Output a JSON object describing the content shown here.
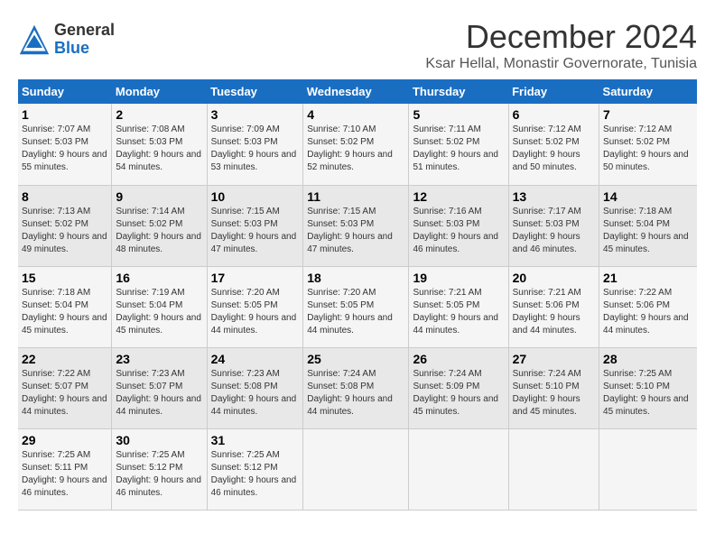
{
  "logo": {
    "general": "General",
    "blue": "Blue"
  },
  "title": "December 2024",
  "subtitle": "Ksar Hellal, Monastir Governorate, Tunisia",
  "days_of_week": [
    "Sunday",
    "Monday",
    "Tuesday",
    "Wednesday",
    "Thursday",
    "Friday",
    "Saturday"
  ],
  "weeks": [
    [
      {
        "day": "1",
        "sunrise": "Sunrise: 7:07 AM",
        "sunset": "Sunset: 5:03 PM",
        "daylight": "Daylight: 9 hours and 55 minutes."
      },
      {
        "day": "2",
        "sunrise": "Sunrise: 7:08 AM",
        "sunset": "Sunset: 5:03 PM",
        "daylight": "Daylight: 9 hours and 54 minutes."
      },
      {
        "day": "3",
        "sunrise": "Sunrise: 7:09 AM",
        "sunset": "Sunset: 5:03 PM",
        "daylight": "Daylight: 9 hours and 53 minutes."
      },
      {
        "day": "4",
        "sunrise": "Sunrise: 7:10 AM",
        "sunset": "Sunset: 5:02 PM",
        "daylight": "Daylight: 9 hours and 52 minutes."
      },
      {
        "day": "5",
        "sunrise": "Sunrise: 7:11 AM",
        "sunset": "Sunset: 5:02 PM",
        "daylight": "Daylight: 9 hours and 51 minutes."
      },
      {
        "day": "6",
        "sunrise": "Sunrise: 7:12 AM",
        "sunset": "Sunset: 5:02 PM",
        "daylight": "Daylight: 9 hours and 50 minutes."
      },
      {
        "day": "7",
        "sunrise": "Sunrise: 7:12 AM",
        "sunset": "Sunset: 5:02 PM",
        "daylight": "Daylight: 9 hours and 50 minutes."
      }
    ],
    [
      {
        "day": "8",
        "sunrise": "Sunrise: 7:13 AM",
        "sunset": "Sunset: 5:02 PM",
        "daylight": "Daylight: 9 hours and 49 minutes."
      },
      {
        "day": "9",
        "sunrise": "Sunrise: 7:14 AM",
        "sunset": "Sunset: 5:02 PM",
        "daylight": "Daylight: 9 hours and 48 minutes."
      },
      {
        "day": "10",
        "sunrise": "Sunrise: 7:15 AM",
        "sunset": "Sunset: 5:03 PM",
        "daylight": "Daylight: 9 hours and 47 minutes."
      },
      {
        "day": "11",
        "sunrise": "Sunrise: 7:15 AM",
        "sunset": "Sunset: 5:03 PM",
        "daylight": "Daylight: 9 hours and 47 minutes."
      },
      {
        "day": "12",
        "sunrise": "Sunrise: 7:16 AM",
        "sunset": "Sunset: 5:03 PM",
        "daylight": "Daylight: 9 hours and 46 minutes."
      },
      {
        "day": "13",
        "sunrise": "Sunrise: 7:17 AM",
        "sunset": "Sunset: 5:03 PM",
        "daylight": "Daylight: 9 hours and 46 minutes."
      },
      {
        "day": "14",
        "sunrise": "Sunrise: 7:18 AM",
        "sunset": "Sunset: 5:04 PM",
        "daylight": "Daylight: 9 hours and 45 minutes."
      }
    ],
    [
      {
        "day": "15",
        "sunrise": "Sunrise: 7:18 AM",
        "sunset": "Sunset: 5:04 PM",
        "daylight": "Daylight: 9 hours and 45 minutes."
      },
      {
        "day": "16",
        "sunrise": "Sunrise: 7:19 AM",
        "sunset": "Sunset: 5:04 PM",
        "daylight": "Daylight: 9 hours and 45 minutes."
      },
      {
        "day": "17",
        "sunrise": "Sunrise: 7:20 AM",
        "sunset": "Sunset: 5:05 PM",
        "daylight": "Daylight: 9 hours and 44 minutes."
      },
      {
        "day": "18",
        "sunrise": "Sunrise: 7:20 AM",
        "sunset": "Sunset: 5:05 PM",
        "daylight": "Daylight: 9 hours and 44 minutes."
      },
      {
        "day": "19",
        "sunrise": "Sunrise: 7:21 AM",
        "sunset": "Sunset: 5:05 PM",
        "daylight": "Daylight: 9 hours and 44 minutes."
      },
      {
        "day": "20",
        "sunrise": "Sunrise: 7:21 AM",
        "sunset": "Sunset: 5:06 PM",
        "daylight": "Daylight: 9 hours and 44 minutes."
      },
      {
        "day": "21",
        "sunrise": "Sunrise: 7:22 AM",
        "sunset": "Sunset: 5:06 PM",
        "daylight": "Daylight: 9 hours and 44 minutes."
      }
    ],
    [
      {
        "day": "22",
        "sunrise": "Sunrise: 7:22 AM",
        "sunset": "Sunset: 5:07 PM",
        "daylight": "Daylight: 9 hours and 44 minutes."
      },
      {
        "day": "23",
        "sunrise": "Sunrise: 7:23 AM",
        "sunset": "Sunset: 5:07 PM",
        "daylight": "Daylight: 9 hours and 44 minutes."
      },
      {
        "day": "24",
        "sunrise": "Sunrise: 7:23 AM",
        "sunset": "Sunset: 5:08 PM",
        "daylight": "Daylight: 9 hours and 44 minutes."
      },
      {
        "day": "25",
        "sunrise": "Sunrise: 7:24 AM",
        "sunset": "Sunset: 5:08 PM",
        "daylight": "Daylight: 9 hours and 44 minutes."
      },
      {
        "day": "26",
        "sunrise": "Sunrise: 7:24 AM",
        "sunset": "Sunset: 5:09 PM",
        "daylight": "Daylight: 9 hours and 45 minutes."
      },
      {
        "day": "27",
        "sunrise": "Sunrise: 7:24 AM",
        "sunset": "Sunset: 5:10 PM",
        "daylight": "Daylight: 9 hours and 45 minutes."
      },
      {
        "day": "28",
        "sunrise": "Sunrise: 7:25 AM",
        "sunset": "Sunset: 5:10 PM",
        "daylight": "Daylight: 9 hours and 45 minutes."
      }
    ],
    [
      {
        "day": "29",
        "sunrise": "Sunrise: 7:25 AM",
        "sunset": "Sunset: 5:11 PM",
        "daylight": "Daylight: 9 hours and 46 minutes."
      },
      {
        "day": "30",
        "sunrise": "Sunrise: 7:25 AM",
        "sunset": "Sunset: 5:12 PM",
        "daylight": "Daylight: 9 hours and 46 minutes."
      },
      {
        "day": "31",
        "sunrise": "Sunrise: 7:25 AM",
        "sunset": "Sunset: 5:12 PM",
        "daylight": "Daylight: 9 hours and 46 minutes."
      },
      null,
      null,
      null,
      null
    ]
  ]
}
